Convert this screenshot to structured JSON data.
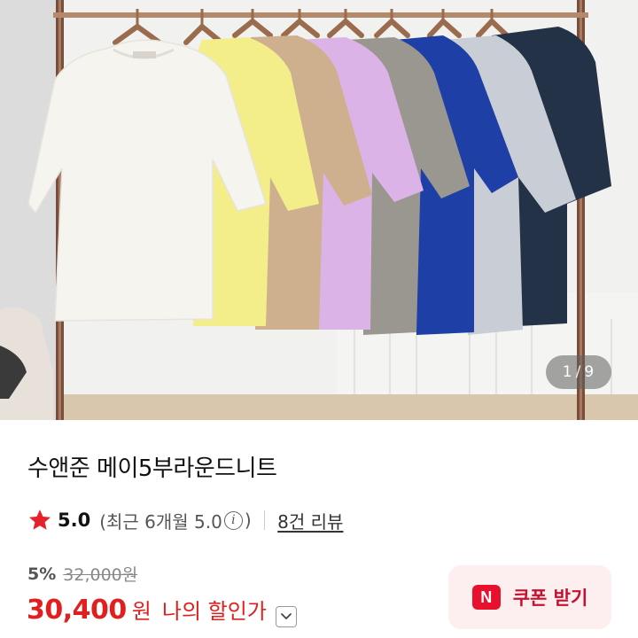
{
  "gallery": {
    "current_page": "1",
    "separator": "/",
    "total_pages": "9",
    "image_subject": "eight short-sleeve knit tops hanging on a rack",
    "colors": [
      "#f5f4ef",
      "#f3ee8a",
      "#cfb08e",
      "#dcb3e6",
      "#9a9690",
      "#1e3fa6",
      "#c9cdd6",
      "#243247"
    ]
  },
  "product": {
    "title": "수앤준 메이5부라운드니트"
  },
  "rating": {
    "icon": "star-icon",
    "star_color": "#e8202a",
    "score": "5.0",
    "recent_text": "(최근 6개월 5.0",
    "recent_close": ")",
    "review_link": "8건 리뷰"
  },
  "price": {
    "discount_rate": "5%",
    "original_price": "32,000원",
    "sale_price": "30,400",
    "sale_unit": "원",
    "my_price_label": "나의 할인가",
    "accent_color": "#e0201f"
  },
  "coupon": {
    "badge": "N",
    "label": "쿠폰 받기",
    "background": "#fdeff0"
  }
}
